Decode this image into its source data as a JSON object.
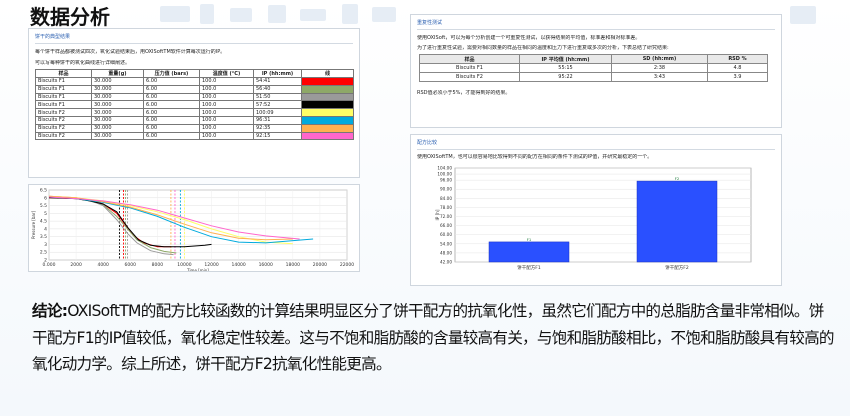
{
  "slide": {
    "title": "数据分析",
    "conclusion_label": "结论:",
    "conclusion_text": "OXISoftTM的配方比较函数的计算结果明显区分了饼干配方的抗氧化性，虽然它们配方中的总脂肪含量非常相似。饼干配方F1的IP值较低，氧化稳定性较差。这与不饱和脂肪酸的含量较高有关，与饱和脂肪酸相比，不饱和脂肪酸具有较高的氧化动力学。综上所述，饼干配方F2抗氧化性能更高。"
  },
  "cookie_panel": {
    "section_title": "饼干的典型结果",
    "line1": "每个饼干样品都被测试四次，氧化试验结束后，用OXISoftTM软件计算每次运行的IP。",
    "line2": "可以写每种饼干的氧化曲线进行详细阐述。",
    "headers": [
      "样品",
      "重量(g)",
      "压力值 (bars)",
      "温度值 (°C)",
      "IP (hh:mm)",
      "线"
    ],
    "rows": [
      {
        "sample": "Biscuits F1",
        "weight": "30.000",
        "pressure": "6.00",
        "temp": "100.0",
        "ip": "54:41",
        "color": "#ff0000"
      },
      {
        "sample": "Biscuits F1",
        "weight": "30.000",
        "pressure": "6.00",
        "temp": "100.0",
        "ip": "56:40",
        "color": "#8ea868"
      },
      {
        "sample": "Biscuits F1",
        "weight": "30.000",
        "pressure": "6.00",
        "temp": "100.0",
        "ip": "51:50",
        "color": "#9a9a9a"
      },
      {
        "sample": "Biscuits F1",
        "weight": "30.000",
        "pressure": "6.00",
        "temp": "100.0",
        "ip": "57:52",
        "color": "#000000"
      },
      {
        "sample": "Biscuits F2",
        "weight": "30.000",
        "pressure": "6.00",
        "temp": "100.0",
        "ip": "100:09",
        "color": "#ffff66"
      },
      {
        "sample": "Biscuits F2",
        "weight": "30.000",
        "pressure": "6.00",
        "temp": "100.0",
        "ip": "96:31",
        "color": "#00aadd"
      },
      {
        "sample": "Biscuits F2",
        "weight": "30.000",
        "pressure": "6.00",
        "temp": "100.0",
        "ip": "92:35",
        "color": "#ffb050"
      },
      {
        "sample": "Biscuits F2",
        "weight": "30.000",
        "pressure": "6.00",
        "temp": "100.0",
        "ip": "92:15",
        "color": "#ff66cc"
      }
    ]
  },
  "repeat_panel": {
    "section_title": "重复性测试",
    "line1": "使用OXISoft，可以为每个分析创建一个可重复性测试，以获得结果的平均值，标准差和相对标准差。",
    "line2": "为了进行重复性试验，需要对相同数量的样品在相同的温度和压力下进行重复或多次的分析，下表总结了研究结果:",
    "headers": [
      "样品",
      "IP 平均值 (hh:mm)",
      "SD (hh:mm)",
      "RSD %"
    ],
    "rows": [
      {
        "sample": "Biscuits F1",
        "ip": "55:15",
        "sd": "2:38",
        "rsd": "4.8"
      },
      {
        "sample": "Biscuits F2",
        "ip": "95:22",
        "sd": "3:43",
        "rsd": "3.9"
      }
    ],
    "note": "RSD值必须小于5%，才能得到好的结果。"
  },
  "chart_data": [
    {
      "type": "line",
      "title": "",
      "xlabel": "Time [min]",
      "ylabel": "Pressure [bar]",
      "xlim": [
        0,
        22000
      ],
      "ylim": [
        2,
        6.5
      ],
      "x_ticks": [
        "0.000",
        "2000",
        "4000",
        "6000",
        "8000",
        "10000",
        "12000",
        "14000",
        "16000",
        "18000",
        "20000",
        "22000"
      ],
      "y_ticks": [
        "2",
        "2.5",
        "3",
        "3.5",
        "4",
        "4.5",
        "5",
        "5.5",
        "6",
        "6.5"
      ],
      "grid": true,
      "series": [
        {
          "color": "#ff0000",
          "points": [
            [
              0,
              6.0
            ],
            [
              2000,
              5.95
            ],
            [
              3000,
              5.85
            ],
            [
              4000,
              5.6
            ],
            [
              5000,
              5.0
            ],
            [
              5600,
              4.3
            ],
            [
              6200,
              3.6
            ],
            [
              7000,
              3.1
            ],
            [
              8000,
              2.85
            ],
            [
              9000,
              2.85
            ]
          ]
        },
        {
          "color": "#8ea868",
          "points": [
            [
              0,
              6.05
            ],
            [
              2000,
              5.95
            ],
            [
              3000,
              5.8
            ],
            [
              4000,
              5.55
            ],
            [
              5000,
              4.8
            ],
            [
              5800,
              4.0
            ],
            [
              6500,
              3.3
            ],
            [
              7500,
              2.8
            ],
            [
              8500,
              2.55
            ],
            [
              9400,
              2.45
            ]
          ]
        },
        {
          "color": "#9a9a9a",
          "points": [
            [
              0,
              6.1
            ],
            [
              2000,
              6.0
            ],
            [
              3000,
              5.85
            ],
            [
              4000,
              5.5
            ],
            [
              5000,
              4.6
            ],
            [
              5800,
              3.7
            ],
            [
              6500,
              3.1
            ],
            [
              7500,
              2.6
            ],
            [
              8500,
              2.4
            ],
            [
              9200,
              2.35
            ]
          ]
        },
        {
          "color": "#000000",
          "points": [
            [
              0,
              6.0
            ],
            [
              2000,
              5.95
            ],
            [
              3000,
              5.8
            ],
            [
              4000,
              5.6
            ],
            [
              5000,
              5.1
            ],
            [
              5800,
              4.1
            ],
            [
              6600,
              3.3
            ],
            [
              7500,
              2.95
            ],
            [
              8500,
              2.85
            ],
            [
              10000,
              2.85
            ],
            [
              11500,
              2.95
            ],
            [
              12000,
              3.0
            ]
          ]
        },
        {
          "color": "#ffff66",
          "points": [
            [
              0,
              6.1
            ],
            [
              2000,
              6.0
            ],
            [
              4000,
              5.8
            ],
            [
              6000,
              5.5
            ],
            [
              8000,
              5.1
            ],
            [
              10000,
              4.6
            ],
            [
              12000,
              4.0
            ],
            [
              14000,
              3.5
            ],
            [
              16000,
              3.15
            ],
            [
              18000,
              3.05
            ]
          ]
        },
        {
          "color": "#00aadd",
          "points": [
            [
              0,
              6.05
            ],
            [
              2000,
              5.95
            ],
            [
              4000,
              5.7
            ],
            [
              6000,
              5.35
            ],
            [
              8000,
              4.8
            ],
            [
              10000,
              4.1
            ],
            [
              12000,
              3.5
            ],
            [
              14000,
              3.15
            ],
            [
              16000,
              3.1
            ],
            [
              19500,
              3.35
            ]
          ]
        },
        {
          "color": "#ffb050",
          "points": [
            [
              0,
              6.1
            ],
            [
              2000,
              6.0
            ],
            [
              4000,
              5.75
            ],
            [
              6000,
              5.4
            ],
            [
              8000,
              4.9
            ],
            [
              10000,
              4.3
            ],
            [
              12000,
              3.75
            ],
            [
              14000,
              3.4
            ],
            [
              16000,
              3.3
            ],
            [
              18000,
              3.35
            ]
          ]
        },
        {
          "color": "#ff66cc",
          "points": [
            [
              0,
              6.05
            ],
            [
              2000,
              5.95
            ],
            [
              4000,
              5.8
            ],
            [
              6000,
              5.55
            ],
            [
              8000,
              5.2
            ],
            [
              10000,
              4.7
            ],
            [
              12000,
              4.2
            ],
            [
              14000,
              3.8
            ],
            [
              16000,
              3.55
            ],
            [
              18500,
              3.35
            ]
          ]
        }
      ],
      "ip_markers": [
        {
          "x": 5200,
          "color": "#000000"
        },
        {
          "x": 5500,
          "color": "#ff0000"
        },
        {
          "x": 5650,
          "color": "#8ea868"
        },
        {
          "x": 5800,
          "color": "#9a9a9a"
        },
        {
          "x": 9000,
          "color": "#ffb050"
        },
        {
          "x": 9300,
          "color": "#ff66cc"
        },
        {
          "x": 9700,
          "color": "#00aadd"
        },
        {
          "x": 10000,
          "color": "#ffff66"
        }
      ]
    },
    {
      "type": "bar",
      "title": "配方比较",
      "description": "使用OXISoftTM，也可以很容易地比较得到不同的配方在相同的条件下测试的IP值，并研究最稳定的一个。",
      "categories": [
        "饼干配方F1",
        "饼干配方F2"
      ],
      "values": [
        55.25,
        95.37
      ],
      "data_labels": [
        "F1",
        "F2"
      ],
      "ylabel": "IP [h]",
      "ylim": [
        42,
        104
      ],
      "y_ticks": [
        "42.00",
        "48.00",
        "54.00",
        "60.00",
        "66.00",
        "72.00",
        "78.00",
        "84.00",
        "90.00",
        "96.00",
        "100.00",
        "104.00"
      ],
      "bar_color": "#2a50ff",
      "grid": true
    }
  ]
}
